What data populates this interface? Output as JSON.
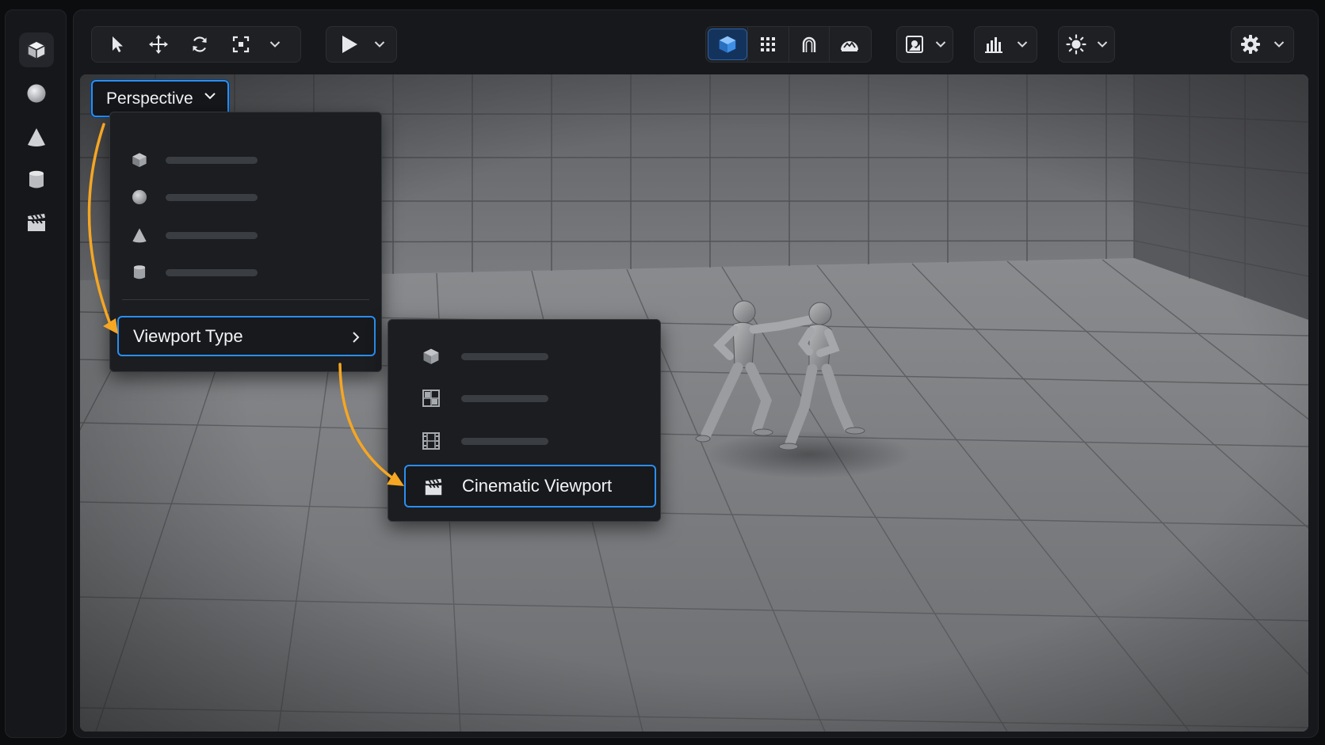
{
  "rail": {
    "items": [
      {
        "icon": "cube-icon"
      },
      {
        "icon": "sphere-icon"
      },
      {
        "icon": "cone-icon"
      },
      {
        "icon": "cylinder-icon"
      },
      {
        "icon": "clapperboard-icon"
      }
    ]
  },
  "toolbar": {
    "transform_tools": [
      "select-arrow-icon",
      "move-icon",
      "rotate-icon",
      "scale-icon"
    ],
    "play": "play-icon",
    "view_modes": [
      "cube-icon",
      "grid-icon",
      "magnet-icon",
      "landscape-icon"
    ],
    "extras": [
      "camera-icon",
      "stats-icon",
      "sun-icon",
      "gear-icon"
    ]
  },
  "viewport": {
    "camera_dropdown_label": "Perspective"
  },
  "menu": {
    "items": [
      {
        "icon": "cube-icon"
      },
      {
        "icon": "sphere-icon"
      },
      {
        "icon": "cone-icon"
      },
      {
        "icon": "cylinder-icon"
      }
    ],
    "submenu_label": "Viewport Type"
  },
  "submenu": {
    "items": [
      {
        "icon": "cube-icon"
      },
      {
        "icon": "layout-grid-icon"
      },
      {
        "icon": "film-strip-icon"
      }
    ],
    "selected_label": "Cinematic Viewport",
    "selected_icon": "clapperboard-icon"
  },
  "colors": {
    "accent": "#2b8ef2",
    "annotation_arrow": "#f5a623",
    "toolbar_bg": "#1e2024"
  }
}
